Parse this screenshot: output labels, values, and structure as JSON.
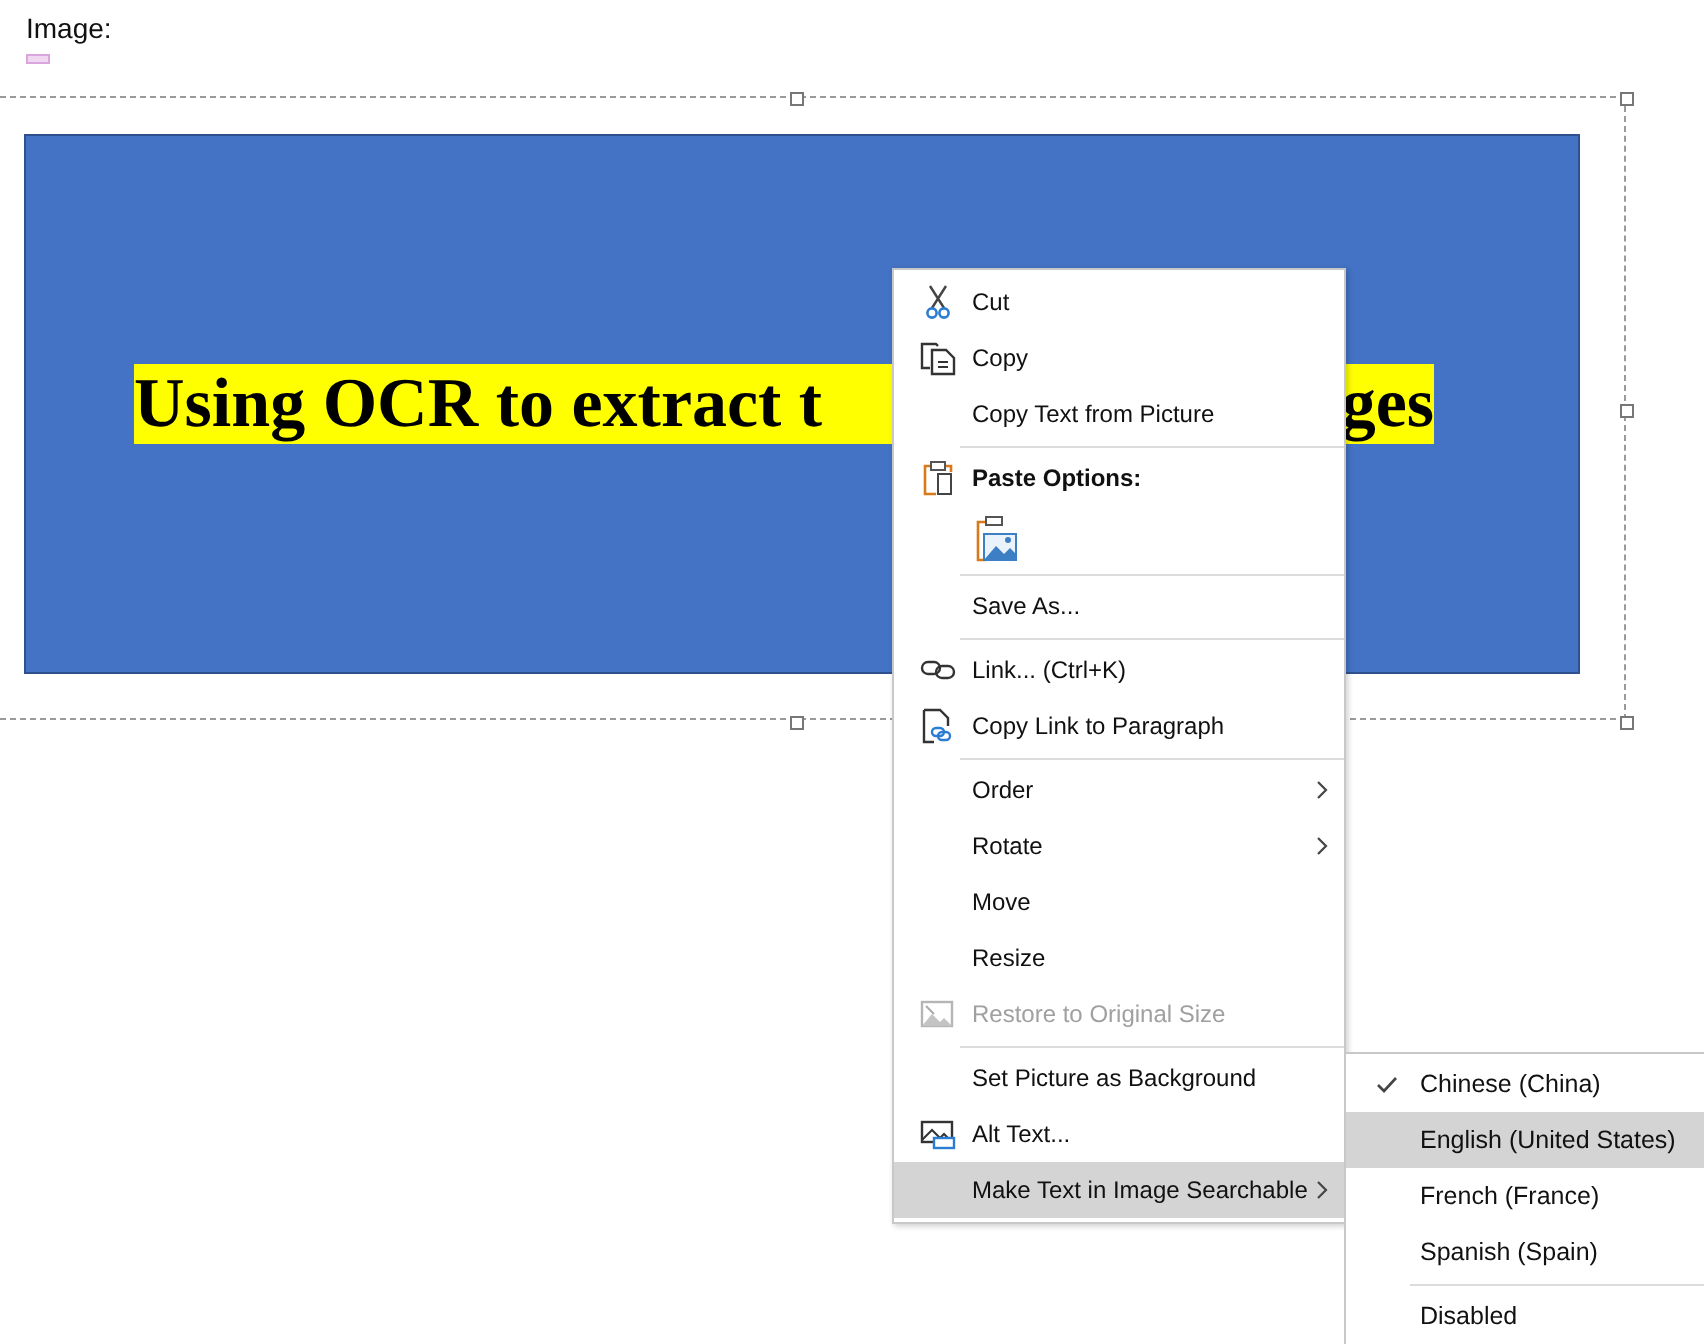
{
  "document": {
    "label": "Image:"
  },
  "image": {
    "caption_parts": [
      "Using OCR to extract t",
      "ges"
    ]
  },
  "context_menu": {
    "items": [
      {
        "kind": "item",
        "label": "Cut",
        "disabled": false,
        "selected": false,
        "submenu": false
      },
      {
        "kind": "item",
        "label": "Copy",
        "disabled": false,
        "selected": false,
        "submenu": false
      },
      {
        "kind": "item",
        "label": "Copy Text from Picture",
        "disabled": false,
        "selected": false,
        "submenu": false
      },
      {
        "kind": "separator"
      },
      {
        "kind": "header",
        "label": "Paste Options:"
      },
      {
        "kind": "paste_option"
      },
      {
        "kind": "separator"
      },
      {
        "kind": "item",
        "label": "Save As...",
        "disabled": false,
        "selected": false,
        "submenu": false
      },
      {
        "kind": "separator"
      },
      {
        "kind": "item",
        "label": "Link...  (Ctrl+K)",
        "disabled": false,
        "selected": false,
        "submenu": false
      },
      {
        "kind": "item",
        "label": "Copy Link to Paragraph",
        "disabled": false,
        "selected": false,
        "submenu": false
      },
      {
        "kind": "separator"
      },
      {
        "kind": "item",
        "label": "Order",
        "disabled": false,
        "selected": false,
        "submenu": true
      },
      {
        "kind": "item",
        "label": "Rotate",
        "disabled": false,
        "selected": false,
        "submenu": true
      },
      {
        "kind": "item",
        "label": "Move",
        "disabled": false,
        "selected": false,
        "submenu": false
      },
      {
        "kind": "item",
        "label": "Resize",
        "disabled": false,
        "selected": false,
        "submenu": false
      },
      {
        "kind": "item",
        "label": "Restore to Original Size",
        "disabled": true,
        "selected": false,
        "submenu": false
      },
      {
        "kind": "separator"
      },
      {
        "kind": "item",
        "label": "Set Picture as Background",
        "disabled": false,
        "selected": false,
        "submenu": false
      },
      {
        "kind": "item",
        "label": "Alt Text...",
        "disabled": false,
        "selected": false,
        "submenu": false
      },
      {
        "kind": "item",
        "label": "Make Text in Image Searchable",
        "disabled": false,
        "selected": true,
        "submenu": true
      }
    ]
  },
  "submenu": {
    "items": [
      {
        "kind": "item",
        "label": "Chinese (China)",
        "checked": true,
        "selected": false
      },
      {
        "kind": "item",
        "label": "English (United States)",
        "checked": false,
        "selected": true
      },
      {
        "kind": "item",
        "label": "French (France)",
        "checked": false,
        "selected": false
      },
      {
        "kind": "item",
        "label": "Spanish (Spain)",
        "checked": false,
        "selected": false
      },
      {
        "kind": "separator"
      },
      {
        "kind": "item",
        "label": "Disabled",
        "checked": false,
        "selected": false
      }
    ]
  }
}
